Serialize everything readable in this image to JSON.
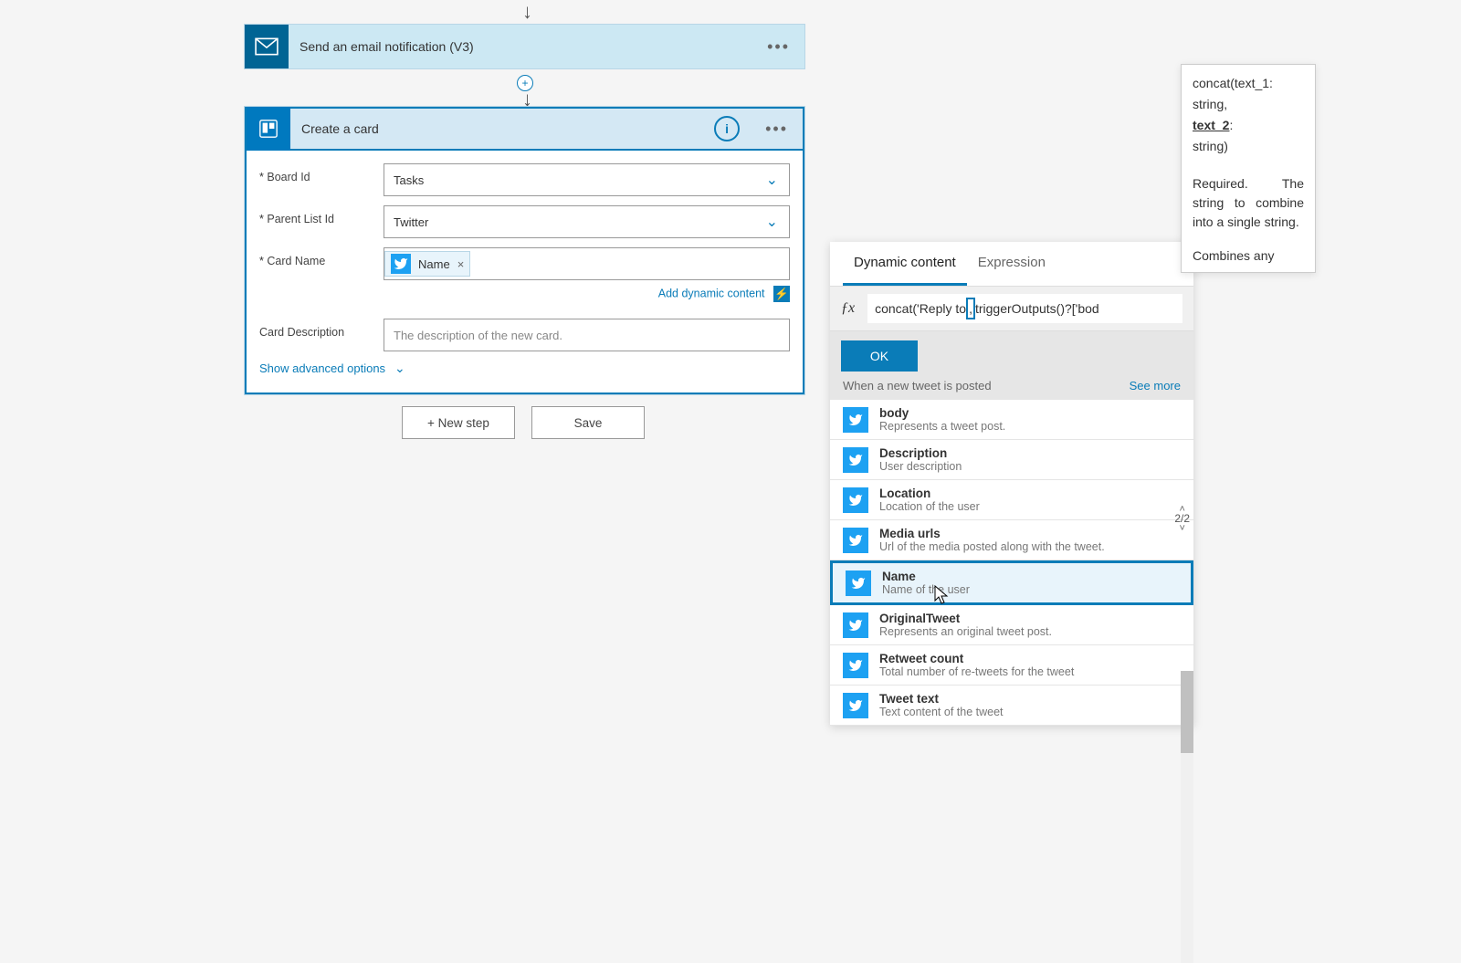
{
  "email_action": {
    "title": "Send an email notification (V3)"
  },
  "trello_action": {
    "title": "Create a card",
    "fields": {
      "board_id": {
        "label": "Board Id",
        "value": "Tasks",
        "required": true
      },
      "parent_list": {
        "label": "Parent List Id",
        "value": "Twitter",
        "required": true
      },
      "card_name": {
        "label": "Card Name",
        "token": "Name",
        "required": true
      },
      "card_desc": {
        "label": "Card Description",
        "placeholder": "The description of the new card."
      }
    },
    "add_dynamic": "Add dynamic content",
    "advanced": "Show advanced options"
  },
  "buttons": {
    "new_step": "+ New step",
    "save": "Save"
  },
  "dyn_panel": {
    "tabs": {
      "dynamic": "Dynamic content",
      "expression": "Expression"
    },
    "formula_prefix": "concat('Reply to ",
    "formula_mid": ",",
    "formula_suffix": "triggerOutputs()?['bod",
    "ok": "OK",
    "section": "When a new tweet is posted",
    "see_more": "See more",
    "count": "2/2",
    "items": [
      {
        "title": "body",
        "desc": "Represents a tweet post."
      },
      {
        "title": "Description",
        "desc": "User description"
      },
      {
        "title": "Location",
        "desc": "Location of the user"
      },
      {
        "title": "Media urls",
        "desc": "Url of the media posted along with the tweet."
      },
      {
        "title": "Name",
        "desc": "Name of the user",
        "selected": true
      },
      {
        "title": "OriginalTweet",
        "desc": "Represents an original tweet post."
      },
      {
        "title": "Retweet count",
        "desc": "Total number of re-tweets for the tweet"
      },
      {
        "title": "Tweet text",
        "desc": "Text content of the tweet"
      }
    ]
  },
  "tooltip": {
    "sig_a": "concat(text_1:",
    "sig_b": "string,",
    "sig_c": "text_2",
    "sig_d": ":",
    "sig_e": "string)",
    "required": "Required. The string to combine into a single string.",
    "cut": "Combines  any"
  }
}
